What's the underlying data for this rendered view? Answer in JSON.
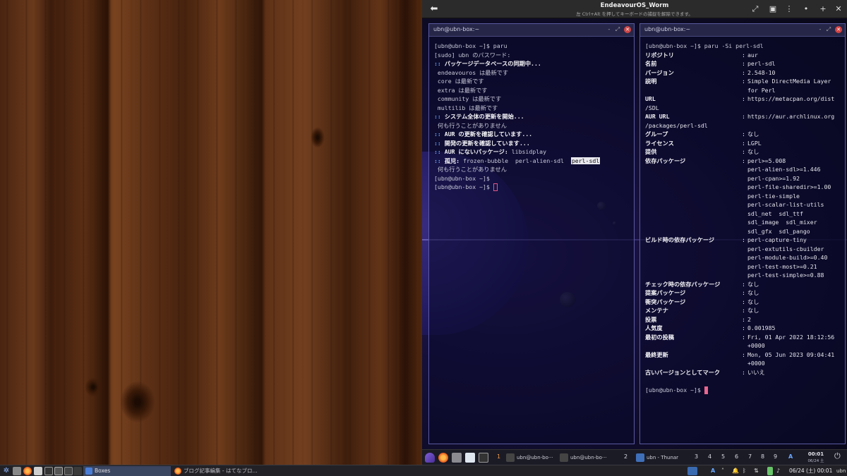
{
  "vm_window": {
    "title": "EndeavourOS_Worm",
    "subtitle": "左 Ctrl+Alt を押してキーボードの捕捉を解除できます。"
  },
  "left_terminal": {
    "title": "ubn@ubn-box:~",
    "lines": [
      {
        "text": "[ubn@ubn-box ~]$ paru",
        "style": "dim"
      },
      {
        "text": "[sudo] ubn のパスワード:",
        "style": "dim"
      },
      {
        "prefix": "::",
        "text": " パッケージデータベースの同期中...",
        "style": "bold"
      },
      {
        "text": " endeavouros は最新です",
        "style": "dim"
      },
      {
        "text": " core は最新です",
        "style": "dim"
      },
      {
        "text": " extra は最新です",
        "style": "dim"
      },
      {
        "text": " community は最新です",
        "style": "dim"
      },
      {
        "text": " multilib は最新です",
        "style": "dim"
      },
      {
        "prefix": "::",
        "text": " システム全体の更新を開始...",
        "style": "bold"
      },
      {
        "text": " 何も行うことがありません",
        "style": "dim"
      },
      {
        "prefix": "::",
        "text": " AUR の更新を確認しています...",
        "style": "bold"
      },
      {
        "prefix": "::",
        "text": " 開発の更新を確認しています...",
        "style": "bold"
      },
      {
        "prefix": "::",
        "text": " AUR にないパッケージ:",
        "extra": " libsidplay",
        "style": "bold"
      },
      {
        "prefix": "::",
        "text": " 孤児:",
        "extra": " frozen-bubble  perl-alien-sdl  ",
        "highlight": "perl-sdl",
        "style": "bold"
      },
      {
        "text": " 何も行うことがありません",
        "style": "dim"
      },
      {
        "text": "[ubn@ubn-box ~]$",
        "style": "dim"
      },
      {
        "text": "[ubn@ubn-box ~]$ ",
        "style": "dim",
        "cursor": "box"
      }
    ]
  },
  "right_terminal": {
    "title": "ubn@ubn-box:~",
    "command": "[ubn@ubn-box ~]$ paru -Si perl-sdl",
    "fields": [
      {
        "key": "リポジトリ",
        "values": [
          "aur"
        ]
      },
      {
        "key": "名前",
        "values": [
          "perl-sdl"
        ]
      },
      {
        "key": "バージョン",
        "values": [
          "2.548-10"
        ]
      },
      {
        "key": "説明",
        "values": [
          "Simple DirectMedia Layer",
          "for Perl"
        ]
      },
      {
        "key": "URL",
        "values": [
          "https://metacpan.org/dist"
        ],
        "wrap": "/SDL"
      },
      {
        "key": "AUR URL",
        "values": [
          "https://aur.archlinux.org"
        ],
        "wrap": "/packages/perl-sdl"
      },
      {
        "key": "グループ",
        "values": [
          "なし"
        ]
      },
      {
        "key": "ライセンス",
        "values": [
          "LGPL"
        ]
      },
      {
        "key": "提供",
        "values": [
          "なし"
        ]
      },
      {
        "key": "依存パッケージ",
        "values": [
          "perl>=5.008",
          "perl-alien-sdl>=1.446",
          "perl-cpan>=1.92",
          "perl-file-sharedir>=1.00",
          "perl-tie-simple",
          "perl-scalar-list-utils",
          "sdl_net  sdl_ttf",
          "sdl_image  sdl_mixer",
          "sdl_gfx  sdl_pango"
        ]
      },
      {
        "key": "ビルド時の依存パッケージ",
        "values": [
          "perl-capture-tiny",
          "perl-extutils-cbuilder",
          "perl-module-build>=0.40",
          "perl-test-most>=0.21",
          "perl-test-simple>=0.88"
        ]
      },
      {
        "key": "チェック時の依存パッケージ",
        "values": [
          "なし"
        ]
      },
      {
        "key": "提案パッケージ",
        "values": [
          "なし"
        ]
      },
      {
        "key": "衝突パッケージ",
        "values": [
          "なし"
        ]
      },
      {
        "key": "メンテナ",
        "values": [
          "なし"
        ]
      },
      {
        "key": "投票",
        "values": [
          "2"
        ]
      },
      {
        "key": "人気度",
        "values": [
          "0.001985"
        ]
      },
      {
        "key": "最初の投稿",
        "values": [
          "Fri, 01 Apr 2022 18:12:56",
          "+0000"
        ]
      },
      {
        "key": "最終更新",
        "values": [
          "Mon, 05 Jun 2023 09:04:41",
          "+0000"
        ]
      },
      {
        "key": "古いバージョンとしてマーク",
        "values": [
          "いいえ"
        ]
      }
    ],
    "prompt": "[ubn@ubn-box ~]$ "
  },
  "guest_panel": {
    "workspaces_left": [
      "1"
    ],
    "tasks": [
      {
        "label": "ubn@ubn-bo···"
      },
      {
        "label": "ubn@ubn-bo···"
      }
    ],
    "workspace_2": "2",
    "thunar": "ubn - Thunar",
    "workspaces_right": [
      "3",
      "4",
      "5",
      "6",
      "7",
      "8",
      "9"
    ],
    "tray_letter": "A",
    "clock": "00:01",
    "date": "06/24 土"
  },
  "host_taskbar": {
    "boxes_label": "Boxes",
    "browser_task": "ブログ記事編集 - はてなブロ...",
    "tray_letter": "A",
    "clock": "06/24 (土) 00:01",
    "user": "ubn"
  },
  "colors": {
    "accent": "#6aa8ff",
    "close": "#d04545",
    "cursor": "#e8668e"
  }
}
